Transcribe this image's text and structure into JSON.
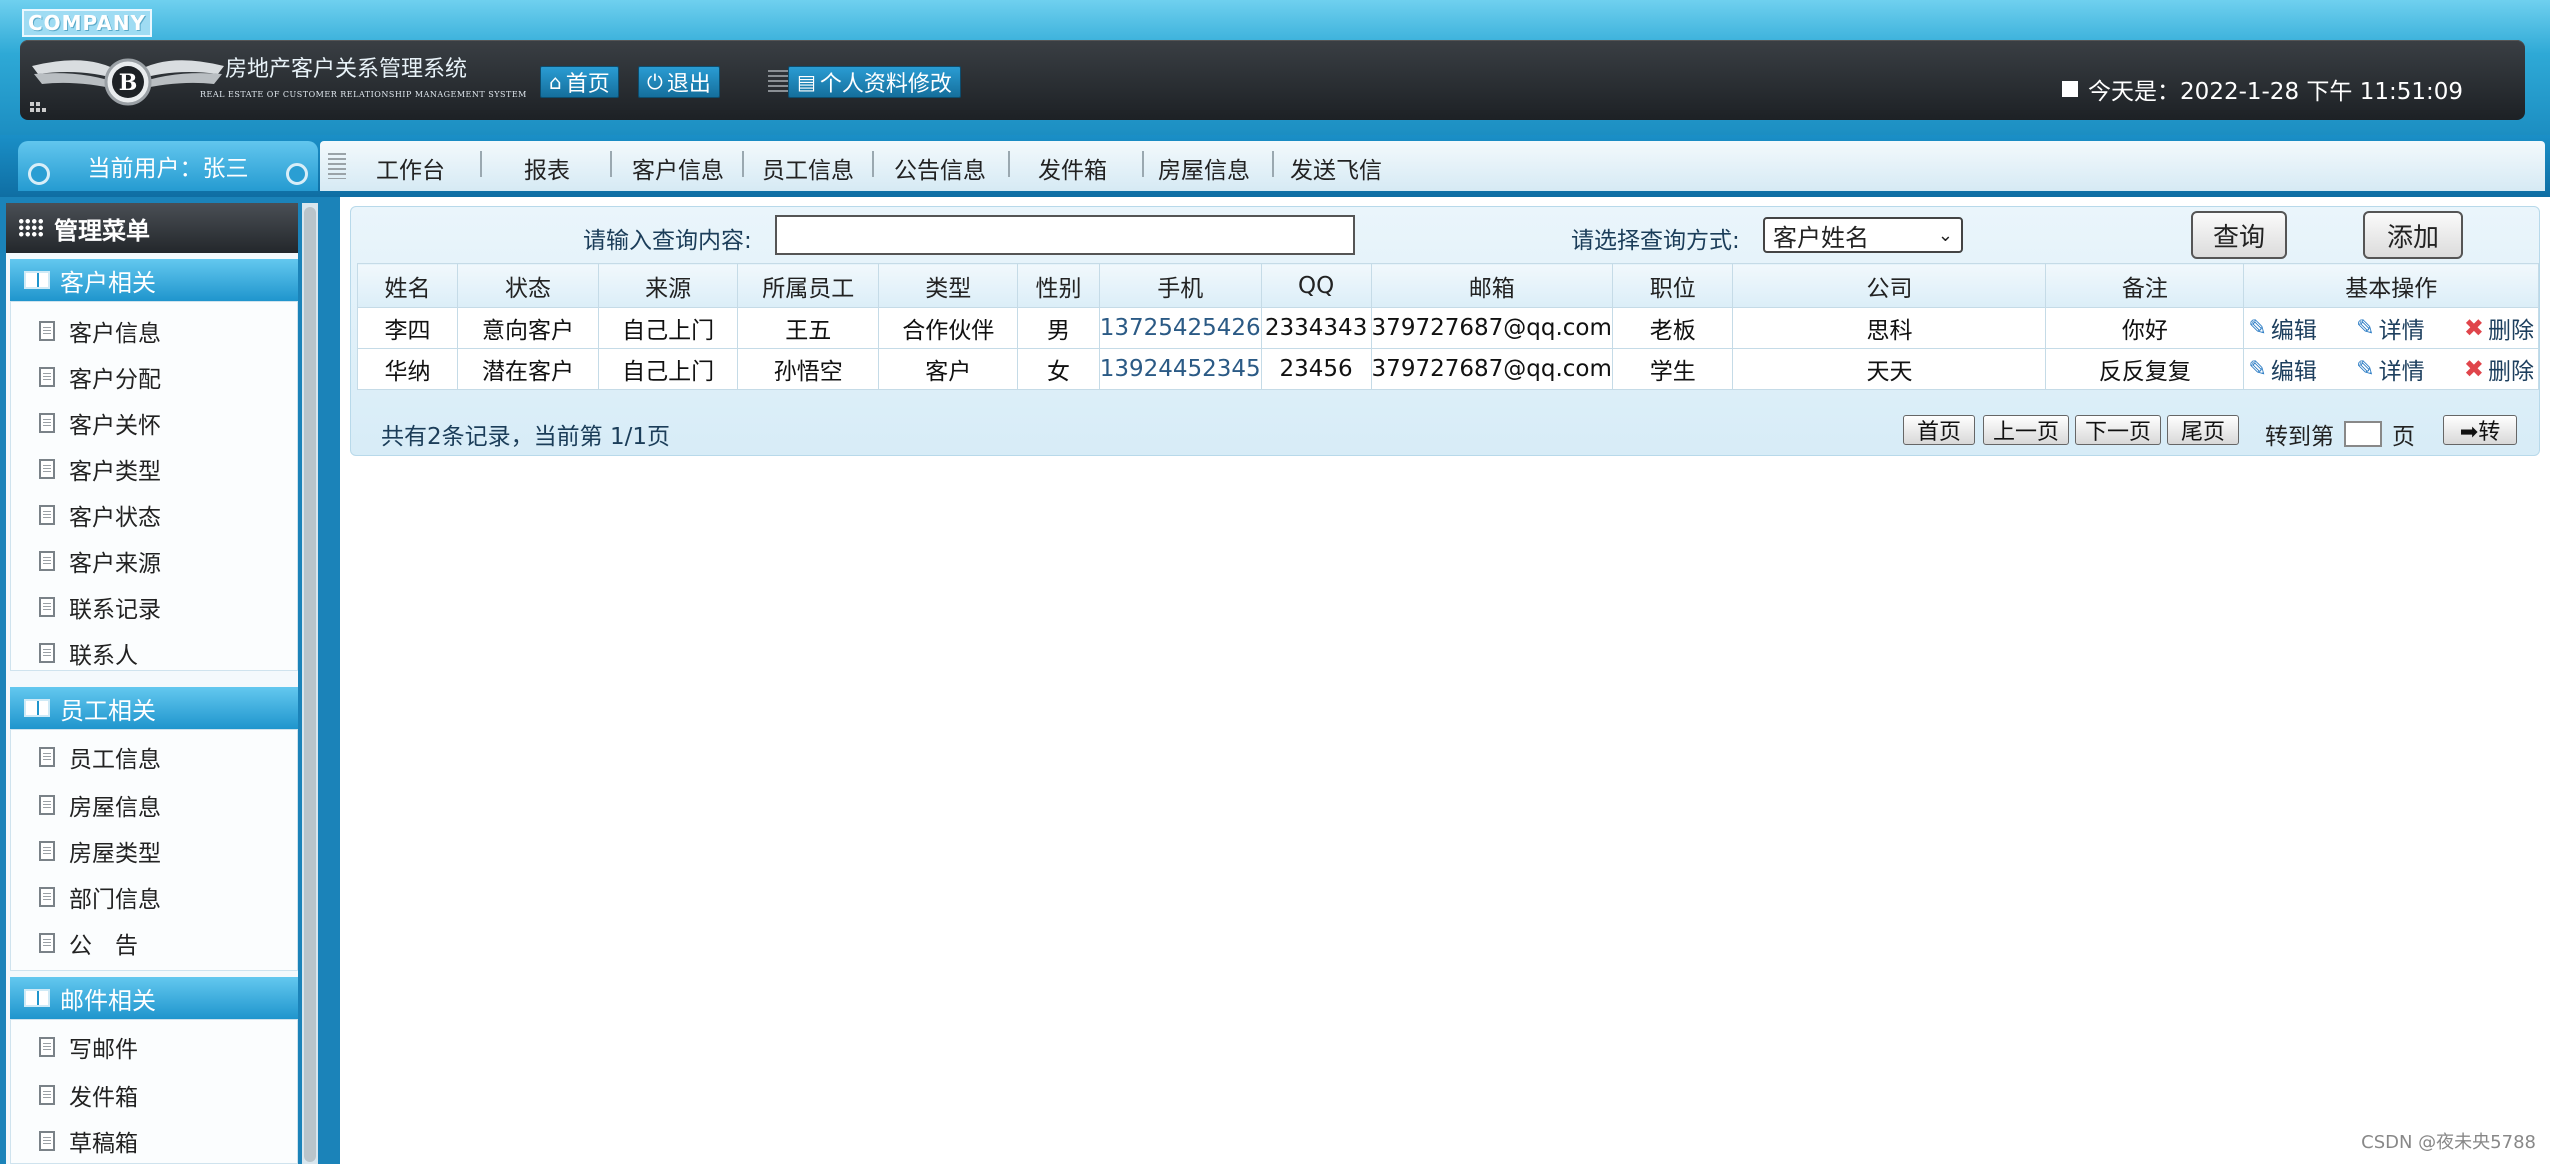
{
  "header": {
    "company": "COMPANY",
    "system_title": "房地产客户关系管理系统",
    "system_subtitle": "REAL ESTATE OF CUSTOMER RELATIONSHIP MANAGEMENT SYSTEM",
    "home_label": "首页",
    "logout_label": "退出",
    "profile_label": "个人资料修改",
    "today_text": "今天是：2022-1-28 下午 11:51:09"
  },
  "nav": {
    "current_user": "当前用户：张三",
    "items": [
      "工作台",
      "报表",
      "客户信息",
      "员工信息",
      "公告信息",
      "发件箱",
      "房屋信息",
      "发送飞信"
    ]
  },
  "sidebar": {
    "title": "管理菜单",
    "groups": [
      {
        "title": "客户相关",
        "items": [
          "客户信息",
          "客户分配",
          "客户关怀",
          "客户类型",
          "客户状态",
          "客户来源",
          "联系记录",
          "联系人"
        ]
      },
      {
        "title": "员工相关",
        "items": [
          "员工信息",
          "房屋信息",
          "房屋类型",
          "部门信息",
          "公　告"
        ]
      },
      {
        "title": "邮件相关",
        "items": [
          "写邮件",
          "发件箱",
          "草稿箱"
        ]
      }
    ]
  },
  "search": {
    "query_label": "请输入查询内容:",
    "query_value": "",
    "method_label": "请选择查询方式:",
    "method_selected": "客户姓名",
    "search_button": "查询",
    "add_button": "添加"
  },
  "table": {
    "headers": [
      "姓名",
      "状态",
      "来源",
      "所属员工",
      "类型",
      "性别",
      "手机",
      "QQ",
      "邮箱",
      "职位",
      "公司",
      "备注",
      "基本操作"
    ],
    "rows": [
      [
        "李四",
        "意向客户",
        "自己上门",
        "王五",
        "合作伙伴",
        "男",
        "13725425426",
        "2334343",
        "379727687@qq.com",
        "老板",
        "思科",
        "你好"
      ],
      [
        "华纳",
        "潜在客户",
        "自己上门",
        "孙悟空",
        "客户",
        "女",
        "13924452345",
        "23456",
        "379727687@qq.com",
        "学生",
        "天天",
        "反反复复"
      ]
    ],
    "actions": {
      "edit": "编辑",
      "detail": "详情",
      "delete": "删除"
    }
  },
  "pager": {
    "info": "共有2条记录，当前第 1/1页",
    "first": "首页",
    "prev": "上一页",
    "next": "下一页",
    "last": "尾页",
    "goto_label": "转到第",
    "page_unit": "页",
    "go_button": "➡转"
  },
  "watermark": "CSDN @夜未央5788",
  "colors": {
    "accent": "#1f95cd",
    "header_dark": "#23272b",
    "link": "#2b5a85",
    "delete": "#e0454b"
  }
}
